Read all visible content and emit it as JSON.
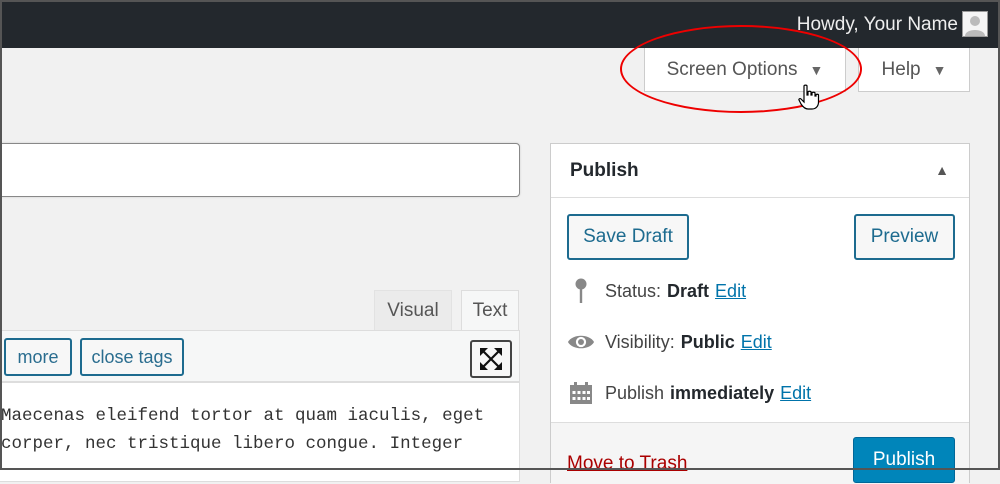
{
  "adminbar": {
    "greeting": "Howdy, Your Name"
  },
  "screen_options": {
    "label": "Screen Options",
    "arrow": "▼"
  },
  "help": {
    "label": "Help",
    "arrow": "▼"
  },
  "editor": {
    "tab_visual": "Visual",
    "tab_text": "Text",
    "quicktags": {
      "more": "more",
      "close_tags": "close tags"
    },
    "content_line1": "Maecenas eleifend tortor at quam iaculis, eget",
    "content_line2": "corper, nec tristique libero congue. Integer"
  },
  "publish": {
    "title": "Publish",
    "toggle": "▲",
    "save_draft": "Save Draft",
    "preview": "Preview",
    "status_label": "Status:",
    "status_value": "Draft",
    "visibility_label": "Visibility:",
    "visibility_value": "Public",
    "publish_label": "Publish",
    "publish_value": "immediately",
    "edit": "Edit",
    "move_to_trash": "Move to Trash",
    "publish_button": "Publish"
  },
  "colors": {
    "accent": "#0085ba",
    "highlight_circle": "#e00000",
    "admin_bar": "#23282d"
  }
}
